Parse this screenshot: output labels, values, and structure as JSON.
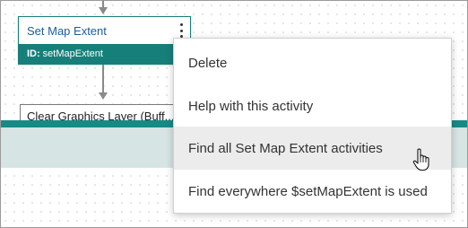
{
  "canvas": {
    "activities": [
      {
        "title": "Set Map Extent",
        "id_label": "ID:",
        "id_value": "setMapExtent",
        "accent": "#177f7a"
      },
      {
        "title": "Clear Graphics Layer (Buff..."
      }
    ]
  },
  "context_menu": {
    "items": [
      {
        "label": "Delete"
      },
      {
        "label": "Help with this activity"
      },
      {
        "label": "Find all Set Map Extent activities"
      },
      {
        "label": "Find everywhere $setMapExtent is used"
      }
    ],
    "highlighted_index": 2
  },
  "icons": [
    "kebab-menu-icon",
    "hand-pointer-cursor-icon",
    "arrow-down-icon"
  ],
  "colors": {
    "teal": "#177f7a",
    "title_blue": "#1b5d9b",
    "menu_hover": "#ececec"
  }
}
